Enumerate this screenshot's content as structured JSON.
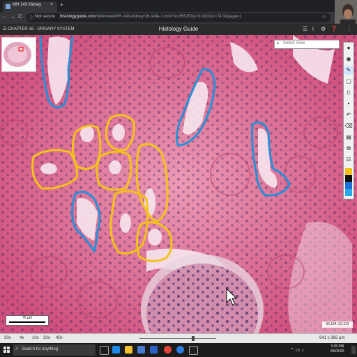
{
  "browser": {
    "tab_title": "MH 143 Kidney",
    "tab_close": "×",
    "new_tab": "+",
    "secure_label": "Not secure",
    "url_domain": "histologyguide.com",
    "url_path": "/slideview/MH-143-kidney/16-slide-1.html?x=35525&y=31832&z=74.3&page=1",
    "nav_back": "←",
    "nav_forward": "→",
    "nav_reload": "C",
    "star": "☆"
  },
  "viewer": {
    "chapter": "CHAPTER 16 - URINARY SYSTEM",
    "app_title": "Histology Guide",
    "toolbar_icons": [
      "☰",
      "i",
      "⚙",
      "❓",
      "⋮"
    ]
  },
  "slide": {
    "select_view_placeholder": "Select View",
    "scale_label": "70 µm",
    "coordinates": "36,194, 52,312",
    "annotation_colors": {
      "yellow": "#f3c21b",
      "blue": "#2a8fd6"
    }
  },
  "right_tools": {
    "icons": [
      "pin-icon",
      "eye-icon",
      "pen-icon",
      "rectangle-icon",
      "ruler-icon",
      "dot-icon",
      "undo-icon",
      "trash-icon",
      "paste-icon",
      "copy-icon",
      "list-icon"
    ],
    "glyphs": [
      "●",
      "◉",
      "✎",
      "▢",
      "📏",
      "•",
      "↶",
      "🗑",
      "▤",
      "⧉",
      "☷"
    ],
    "swatch_colors": [
      "#f3c21b",
      "#111111",
      "#1e6fd6",
      "#28a8e8"
    ]
  },
  "zoom_bar": {
    "levels": [
      "30x",
      "4x",
      "10x",
      "20x",
      "40x"
    ],
    "dimensions": "641 x 366 µm"
  },
  "taskbar": {
    "search_placeholder": "Search for anything",
    "time": "3:35 PM",
    "date": "6/5/2020"
  }
}
